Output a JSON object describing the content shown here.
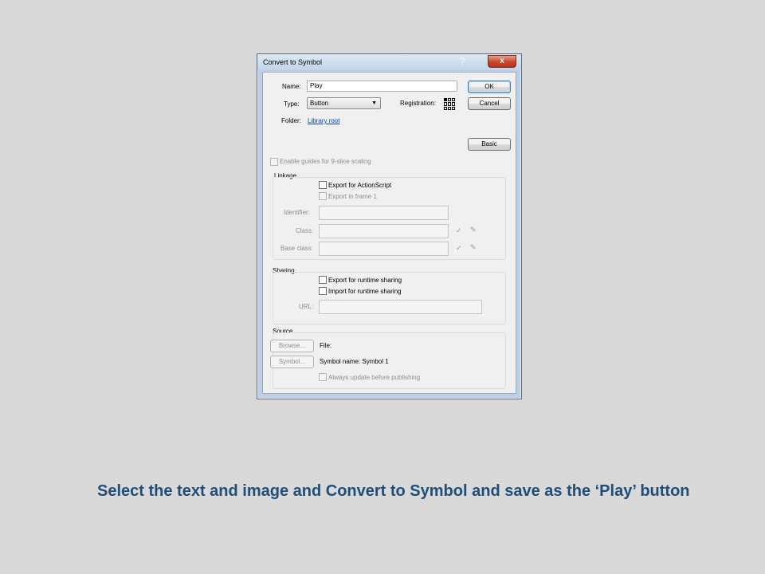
{
  "dialog": {
    "title": "Convert to Symbol",
    "close_label": "x",
    "help_label": "?",
    "name_label": "Name:",
    "name_value": "Play",
    "type_label": "Type:",
    "type_value": "Button",
    "registration_label": "Registration:",
    "folder_label": "Folder:",
    "folder_link": "Library root",
    "ok_label": "OK",
    "cancel_label": "Cancel",
    "basic_label": "Basic",
    "nine_slice_label": "Enable guides for 9-slice scaling",
    "linkage": {
      "title": "Linkage",
      "export_actionscript": "Export for ActionScript",
      "export_frame1": "Export in frame 1",
      "identifier_label": "Identifier:",
      "class_label": "Class:",
      "base_class_label": "Base class:"
    },
    "sharing": {
      "title": "Sharing",
      "export_runtime": "Export for runtime sharing",
      "import_runtime": "Import for runtime sharing",
      "url_label": "URL:"
    },
    "source": {
      "title": "Source",
      "browse_label": "Browse...",
      "symbol_label": "Symbol...",
      "file_label": "File:",
      "symbol_name": "Symbol name: Symbol 1",
      "always_update": "Always update before publishing"
    }
  },
  "caption": "Select the text and image and Convert to Symbol and save as the ‘Play’ button"
}
